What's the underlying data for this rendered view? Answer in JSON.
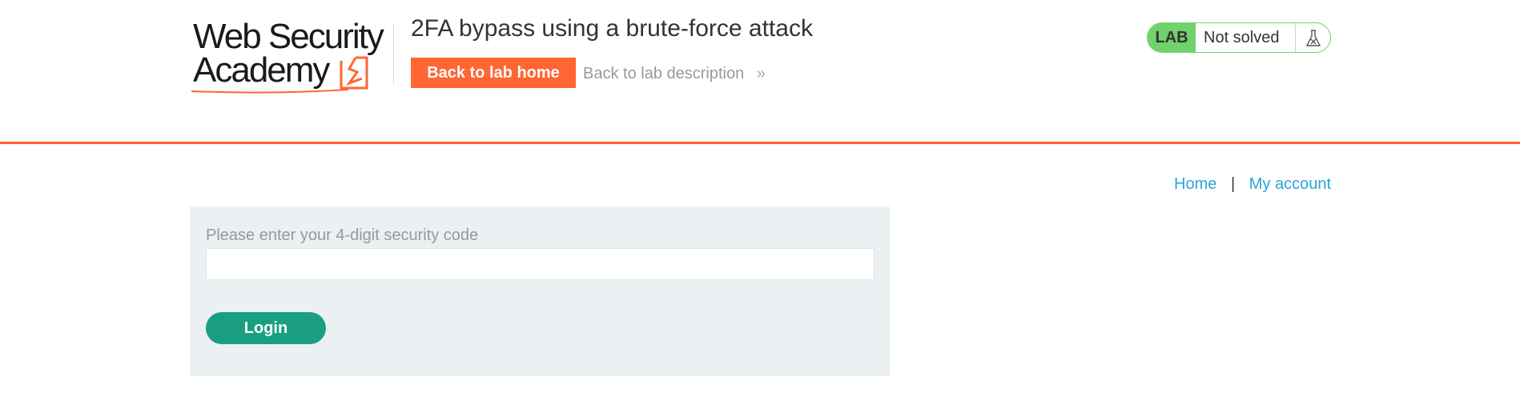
{
  "header": {
    "logo": {
      "line1": "Web Security",
      "line2": "Academy"
    },
    "lab_title": "2FA bypass using a brute-force attack",
    "back_home_label": "Back to lab home",
    "back_description_label": "Back to lab description",
    "lab_status": {
      "tag": "LAB",
      "status": "Not solved",
      "icon": "flask-icon",
      "colors": {
        "tag_bg": "#70d16d"
      }
    }
  },
  "nav": {
    "home": "Home",
    "separator": "|",
    "my_account": "My account"
  },
  "form": {
    "label": "Please enter your 4-digit security code",
    "input_value": "",
    "submit_label": "Login"
  },
  "colors": {
    "accent": "#ff6633",
    "link": "#29a4d9",
    "login_button": "#1a9e81",
    "panel_bg": "#ebf0f2"
  }
}
